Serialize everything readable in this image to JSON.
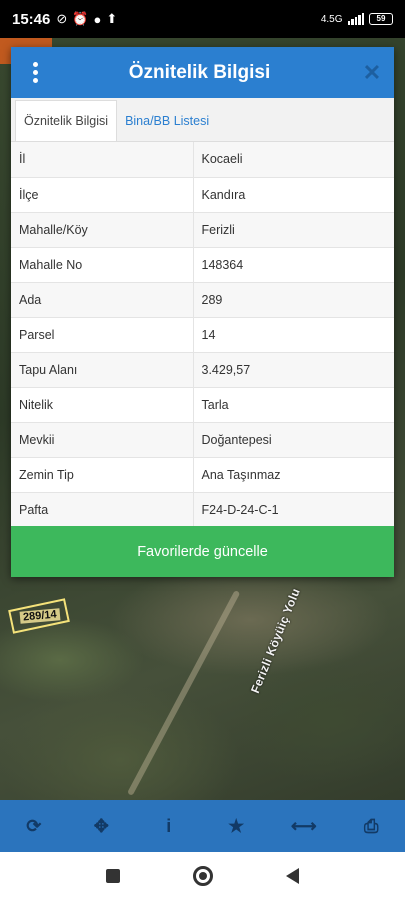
{
  "status_bar": {
    "time": "15:46",
    "network": "4.5G",
    "battery": "59"
  },
  "dialog": {
    "title": "Öznitelik Bilgisi",
    "close_icon": "close-icon",
    "menu_icon": "more-vert-icon",
    "tabs": [
      {
        "label": "Öznitelik Bilgisi",
        "active": true
      },
      {
        "label": "Bina/BB Listesi",
        "active": false
      }
    ],
    "rows": [
      {
        "key": "İl",
        "value": "Kocaeli"
      },
      {
        "key": "İlçe",
        "value": "Kandıra"
      },
      {
        "key": "Mahalle/Köy",
        "value": "Ferizli"
      },
      {
        "key": "Mahalle No",
        "value": "148364"
      },
      {
        "key": "Ada",
        "value": "289"
      },
      {
        "key": "Parsel",
        "value": "14"
      },
      {
        "key": "Tapu Alanı",
        "value": "3.429,57"
      },
      {
        "key": "Nitelik",
        "value": "Tarla"
      },
      {
        "key": "Mevkii",
        "value": "Doğantepesi"
      },
      {
        "key": "Zemin Tip",
        "value": "Ana Taşınmaz"
      },
      {
        "key": "Pafta",
        "value": "F24-D-24-C-1"
      }
    ],
    "update_button": "Favorilerde güncelle"
  },
  "map": {
    "parcel_label": "289/14",
    "road_label": "Ferizli Köyüiç Yolu"
  },
  "toolbar": {
    "icons": [
      "refresh-icon",
      "locate-icon",
      "info-icon",
      "star-icon",
      "measure-icon",
      "print-icon"
    ]
  },
  "colors": {
    "header": "#2b7fd0",
    "button": "#3db85c",
    "toolbar": "#2b74bd"
  }
}
